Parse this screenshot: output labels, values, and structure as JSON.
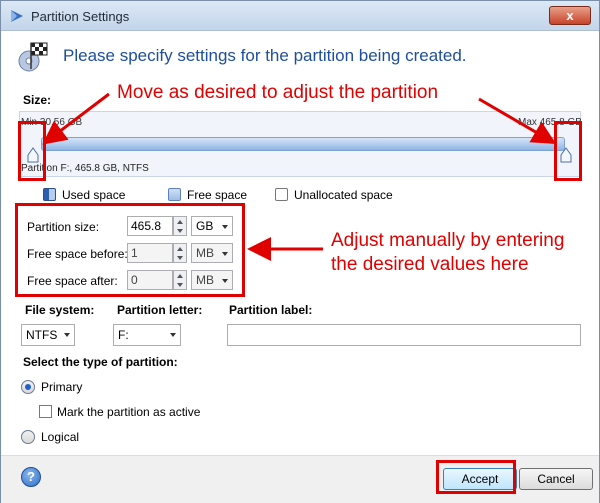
{
  "window": {
    "title": "Partition Settings",
    "close_label": "x"
  },
  "header": {
    "text": "Please specify settings for the partition being created."
  },
  "size": {
    "label": "Size:",
    "min_label": "Min 30.56 GB",
    "max_label": "Max 465.8 GB",
    "partition_info": "Partition F:, 465.8 GB, NTFS"
  },
  "legend": [
    "Used space",
    "Free space",
    "Unallocated space"
  ],
  "fields": {
    "partition_size": {
      "label": "Partition size:",
      "value": "465.8",
      "unit": "GB"
    },
    "free_before": {
      "label": "Free space before:",
      "value": "1",
      "unit": "MB"
    },
    "free_after": {
      "label": "Free space after:",
      "value": "0",
      "unit": "MB"
    }
  },
  "file_system": {
    "label": "File system:",
    "value": "NTFS"
  },
  "partition_letter": {
    "label": "Partition letter:",
    "value": "F:"
  },
  "partition_label": {
    "label": "Partition label:",
    "value": ""
  },
  "partition_type": {
    "label": "Select the type of partition:",
    "primary": "Primary",
    "mark_active": "Mark the partition as active",
    "logical": "Logical"
  },
  "footer": {
    "help": "?",
    "accept": "Accept",
    "cancel": "Cancel"
  },
  "annotations": {
    "top": "Move as desired to adjust the partition",
    "middle_line1": "Adjust manually by entering",
    "middle_line2": "the desired values here"
  },
  "colors": {
    "annotation_red": "#e00000",
    "header_blue": "#1e4e9c"
  }
}
